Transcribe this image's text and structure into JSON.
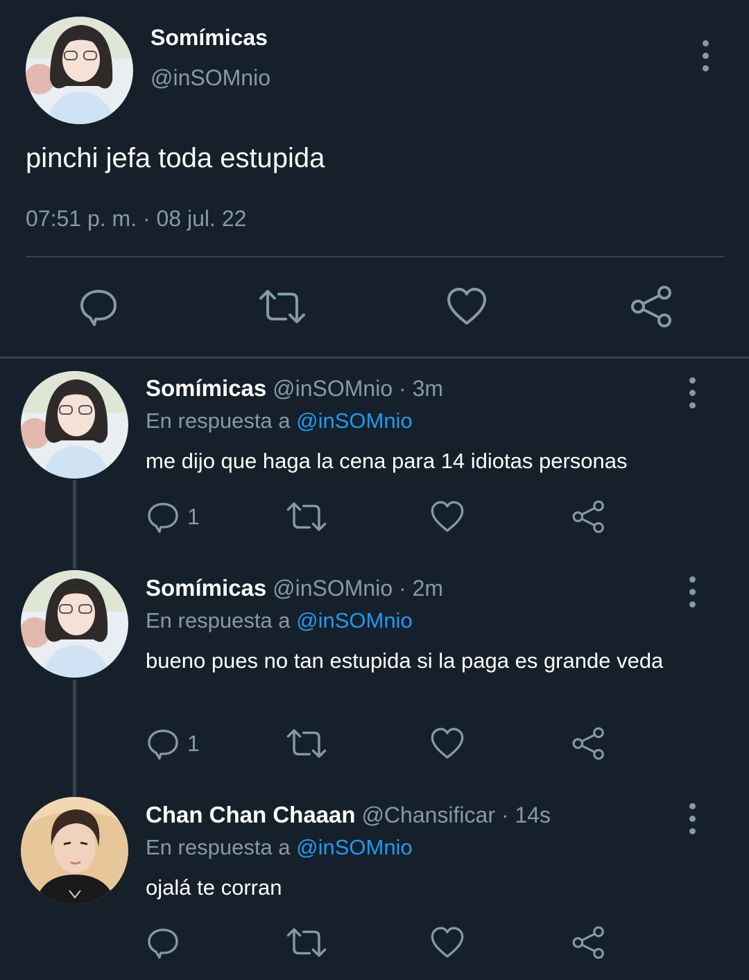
{
  "main_tweet": {
    "display_name": "Somímicas",
    "handle": "@inSOMnio",
    "text": "pinchi jefa toda estupida",
    "timestamp": "07:51 p. m. · 08 jul. 22"
  },
  "replies": [
    {
      "display_name": "Somímicas",
      "handle": "@inSOMnio",
      "time": "· 3m",
      "reply_prefix": "En respuesta a",
      "reply_to": "@inSOMnio",
      "text": "me dijo que haga la cena para 14 idiotas personas",
      "reply_count": "1"
    },
    {
      "display_name": "Somímicas",
      "handle": "@inSOMnio",
      "time": "· 2m",
      "reply_prefix": "En respuesta a",
      "reply_to": "@inSOMnio",
      "text": "bueno pues no tan estupida si la paga es grande veda",
      "reply_count": "1"
    },
    {
      "display_name": "Chan Chan Chaaan",
      "handle": "@Chansificar",
      "time": "· 14s",
      "reply_prefix": "En respuesta a",
      "reply_to": "@inSOMnio",
      "text": "ojalá te corran",
      "reply_count": ""
    }
  ],
  "icons": [
    "reply-icon",
    "retweet-icon",
    "like-icon",
    "share-icon",
    "more-options-icon"
  ],
  "colors": {
    "background": "#15202b",
    "muted": "#8899a6",
    "link": "#1d9bf0",
    "divider": "#38444d"
  }
}
